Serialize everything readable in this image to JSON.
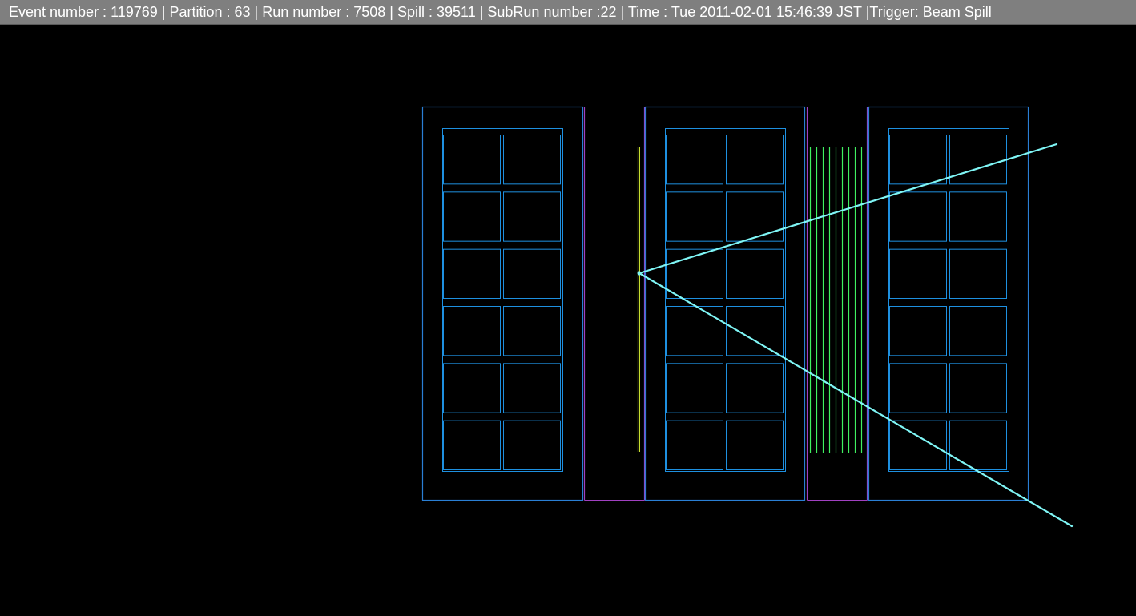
{
  "header": {
    "info_line": "Event number : 119769 | Partition : 63 | Run number : 7508 | Spill : 39511 | SubRun number :22 | Time : Tue 2011-02-01 15:46:39 JST |Trigger: Beam Spill"
  },
  "colors": {
    "header_background": "#7f7f7f",
    "header_text": "#ffffff",
    "background": "#000000",
    "detector_frame": "#2a7fd4",
    "module_cell": "#1e90e0",
    "gap_frame": "#a040c0",
    "vertex_layer": "#e0f040",
    "tracker_planes": "#40f060",
    "track": "#7ff5f5"
  }
}
